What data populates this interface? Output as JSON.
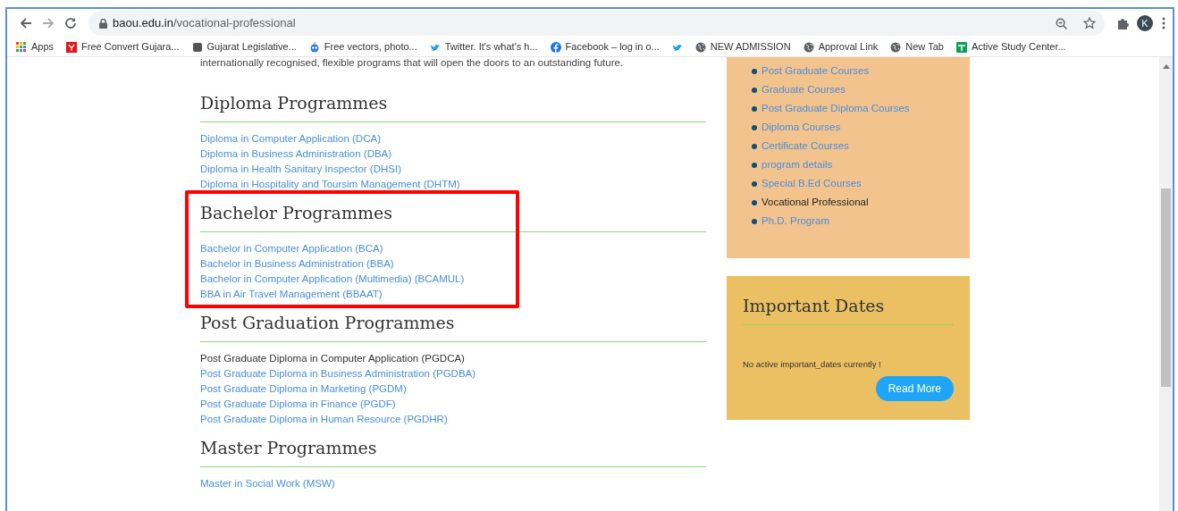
{
  "browser": {
    "url_host": "baou.edu.in",
    "url_path": "/vocational-professional",
    "profile_initial": "K"
  },
  "bookmarks": [
    {
      "kind": "apps",
      "label": "Apps"
    },
    {
      "kind": "red",
      "label": "Free Convert Gujara..."
    },
    {
      "kind": "wiki",
      "label": "Gujarat Legislative..."
    },
    {
      "kind": "robot",
      "label": "Free vectors, photo..."
    },
    {
      "kind": "bird",
      "label": "Twitter. It's what's h..."
    },
    {
      "kind": "facebook",
      "label": "Facebook – log in o..."
    },
    {
      "kind": "bird"
    },
    {
      "kind": "globe",
      "label": "NEW ADMISSION"
    },
    {
      "kind": "globe",
      "label": "Approval Link"
    },
    {
      "kind": "globe",
      "label": "New Tab"
    },
    {
      "kind": "sheet",
      "label": "Active Study Center..."
    }
  ],
  "intro": "internationally recognised, flexible programs that will open the doors to an outstanding future.",
  "sections": [
    {
      "title": "Diploma Programmes",
      "highlighted": false,
      "links": [
        {
          "label": "Diploma in Computer Application (DCA)",
          "active": false
        },
        {
          "label": "Diploma in Business Administration (DBA)",
          "active": false
        },
        {
          "label": "Diploma in Health Sanitary Inspector (DHSI)",
          "active": false
        },
        {
          "label": "Diploma in Hospitality and Toursim Management (DHTM)",
          "active": false
        }
      ]
    },
    {
      "title": "Bachelor Programmes",
      "highlighted": true,
      "links": [
        {
          "label": "Bachelor in Computer Application (BCA)",
          "active": false
        },
        {
          "label": "Bachelor in Business Administration (BBA)",
          "active": false
        },
        {
          "label": "Bachelor in Computer Application (Multimedia) (BCAMUL)",
          "active": false
        },
        {
          "label": "BBA in Air Travel Management (BBAAT)",
          "active": false
        }
      ]
    },
    {
      "title": "Post Graduation Programmes",
      "highlighted": false,
      "links": [
        {
          "label": "Post Graduate Diploma in Computer Application (PGDCA)",
          "active": true
        },
        {
          "label": "Post Graduate Diploma in Business Administration (PGDBA)",
          "active": false
        },
        {
          "label": "Post Graduate Diploma in Marketing (PGDM)",
          "active": false
        },
        {
          "label": "Post Graduate Diploma in Finance (PGDF)",
          "active": false
        },
        {
          "label": "Post Graduate Diploma in Human Resource (PGDHR)",
          "active": false
        }
      ]
    },
    {
      "title": "Master Programmes",
      "highlighted": false,
      "links": [
        {
          "label": "Master in Social Work (MSW)",
          "active": false
        }
      ]
    }
  ],
  "sidebar": {
    "menu": [
      {
        "label": "Post Graduate Courses",
        "selected": false
      },
      {
        "label": "Graduate Courses",
        "selected": false
      },
      {
        "label": "Post Graduate Diploma Courses",
        "selected": false
      },
      {
        "label": "Diploma Courses",
        "selected": false
      },
      {
        "label": "Certificate Courses",
        "selected": false
      },
      {
        "label": "program details",
        "selected": false
      },
      {
        "label": "Special B.Ed Courses",
        "selected": false
      },
      {
        "label": "Vocational Professional",
        "selected": true
      },
      {
        "label": "Ph.D. Program",
        "selected": false
      }
    ],
    "important_dates": {
      "title": "Important Dates",
      "message": "No active important_dates currently !",
      "button": "Read More"
    }
  }
}
